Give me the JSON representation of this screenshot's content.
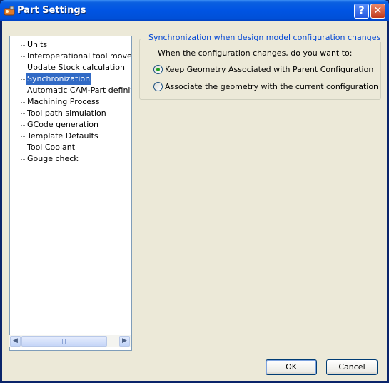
{
  "window": {
    "title": "Part Settings",
    "help_glyph": "?",
    "close_glyph": "✕"
  },
  "tree": {
    "items": [
      "Units",
      "Interoperational tool movement",
      "Update Stock calculation",
      "Synchronization",
      "Automatic CAM-Part definition",
      "Machining Process",
      "Tool path simulation",
      "GCode generation",
      "Template Defaults",
      "Tool Coolant",
      "Gouge check"
    ],
    "selected_index": 3
  },
  "scrollbar": {
    "left_arrow": "◀",
    "right_arrow": "▶"
  },
  "sync": {
    "group_title": "Synchronization when design model configuration changes",
    "question": "When the configuration changes, do you want to:",
    "options": [
      {
        "label": "Keep Geometry Associated with Parent Configuration",
        "checked": true
      },
      {
        "label": "Associate the geometry with the current configuration",
        "checked": false
      }
    ]
  },
  "buttons": {
    "ok": "OK",
    "cancel": "Cancel"
  },
  "colors": {
    "title_bar": "#0054e3",
    "selection": "#316ac5",
    "group_title": "#0046d5",
    "dialog_bg": "#ece9d8"
  }
}
